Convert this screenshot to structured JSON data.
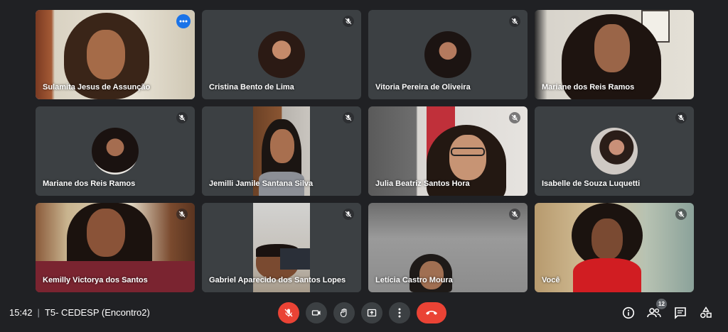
{
  "participants": [
    {
      "name": "Sulamita Jesus de Assunção"
    },
    {
      "name": "Cristina Bento de Lima"
    },
    {
      "name": "Vitoria Pereira de Oliveira"
    },
    {
      "name": "Mariane dos Reis Ramos"
    },
    {
      "name": "Mariane dos Reis Ramos"
    },
    {
      "name": "Jemilli Jamile Santana Silva"
    },
    {
      "name": "Julia Beatriz Santos Hora"
    },
    {
      "name": "Isabelle de Souza Luquetti"
    },
    {
      "name": "Kemilly Victorya dos Santos"
    },
    {
      "name": "Gabriel Aparecido dos Santos Lopes"
    },
    {
      "name": "Letícia Castro Moura"
    },
    {
      "name": "Você"
    }
  ],
  "meeting": {
    "time": "15:42",
    "separator": "|",
    "title": "T5- CEDESP (Encontro2)"
  },
  "participants_count": "12",
  "colors": {
    "end_call": "#ea4335",
    "active_outline": "#8ab4f8",
    "tile_bg": "#3c4043"
  }
}
